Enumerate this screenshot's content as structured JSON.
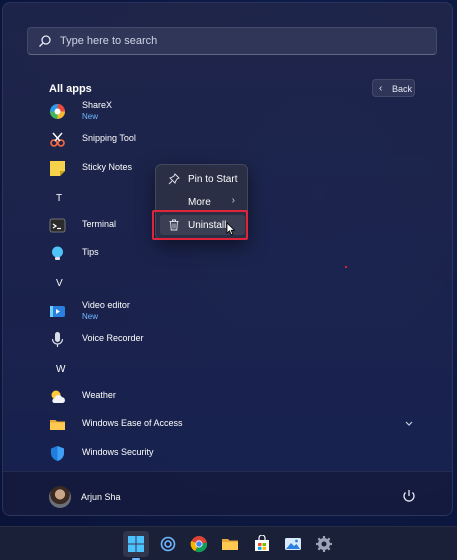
{
  "search": {
    "placeholder": "Type here to search"
  },
  "all_apps": {
    "title": "All apps",
    "back_label": "Back"
  },
  "apps": [
    {
      "name": "ShareX",
      "sub": "New",
      "icon": "sharex-icon"
    },
    {
      "name": "Snipping Tool",
      "icon": "snipping-tool-icon"
    },
    {
      "name": "Sticky Notes",
      "icon": "sticky-notes-icon"
    },
    {
      "letter": "T"
    },
    {
      "name": "Terminal",
      "icon": "terminal-icon"
    },
    {
      "name": "Tips",
      "icon": "tips-icon"
    },
    {
      "letter": "V"
    },
    {
      "name": "Video editor",
      "sub": "New",
      "icon": "video-editor-icon"
    },
    {
      "name": "Voice Recorder",
      "icon": "voice-recorder-icon"
    },
    {
      "letter": "W"
    },
    {
      "name": "Weather",
      "icon": "weather-icon"
    },
    {
      "name": "Windows Ease of Access",
      "icon": "folder-icon"
    },
    {
      "name": "Windows Security",
      "icon": "windows-security-icon"
    }
  ],
  "context_menu": {
    "pin": "Pin to Start",
    "more": "More",
    "uninstall": "Uninstall"
  },
  "user": {
    "name": "Arjun Sha"
  },
  "colors": {
    "accent": "#6fb8ff",
    "highlight": "#e0243a",
    "menu_bg": "#2b2f45"
  },
  "taskbar": [
    "start-icon",
    "widgets-icon",
    "chrome-icon",
    "file-explorer-icon",
    "microsoft-store-icon",
    "photos-icon",
    "settings-icon"
  ]
}
